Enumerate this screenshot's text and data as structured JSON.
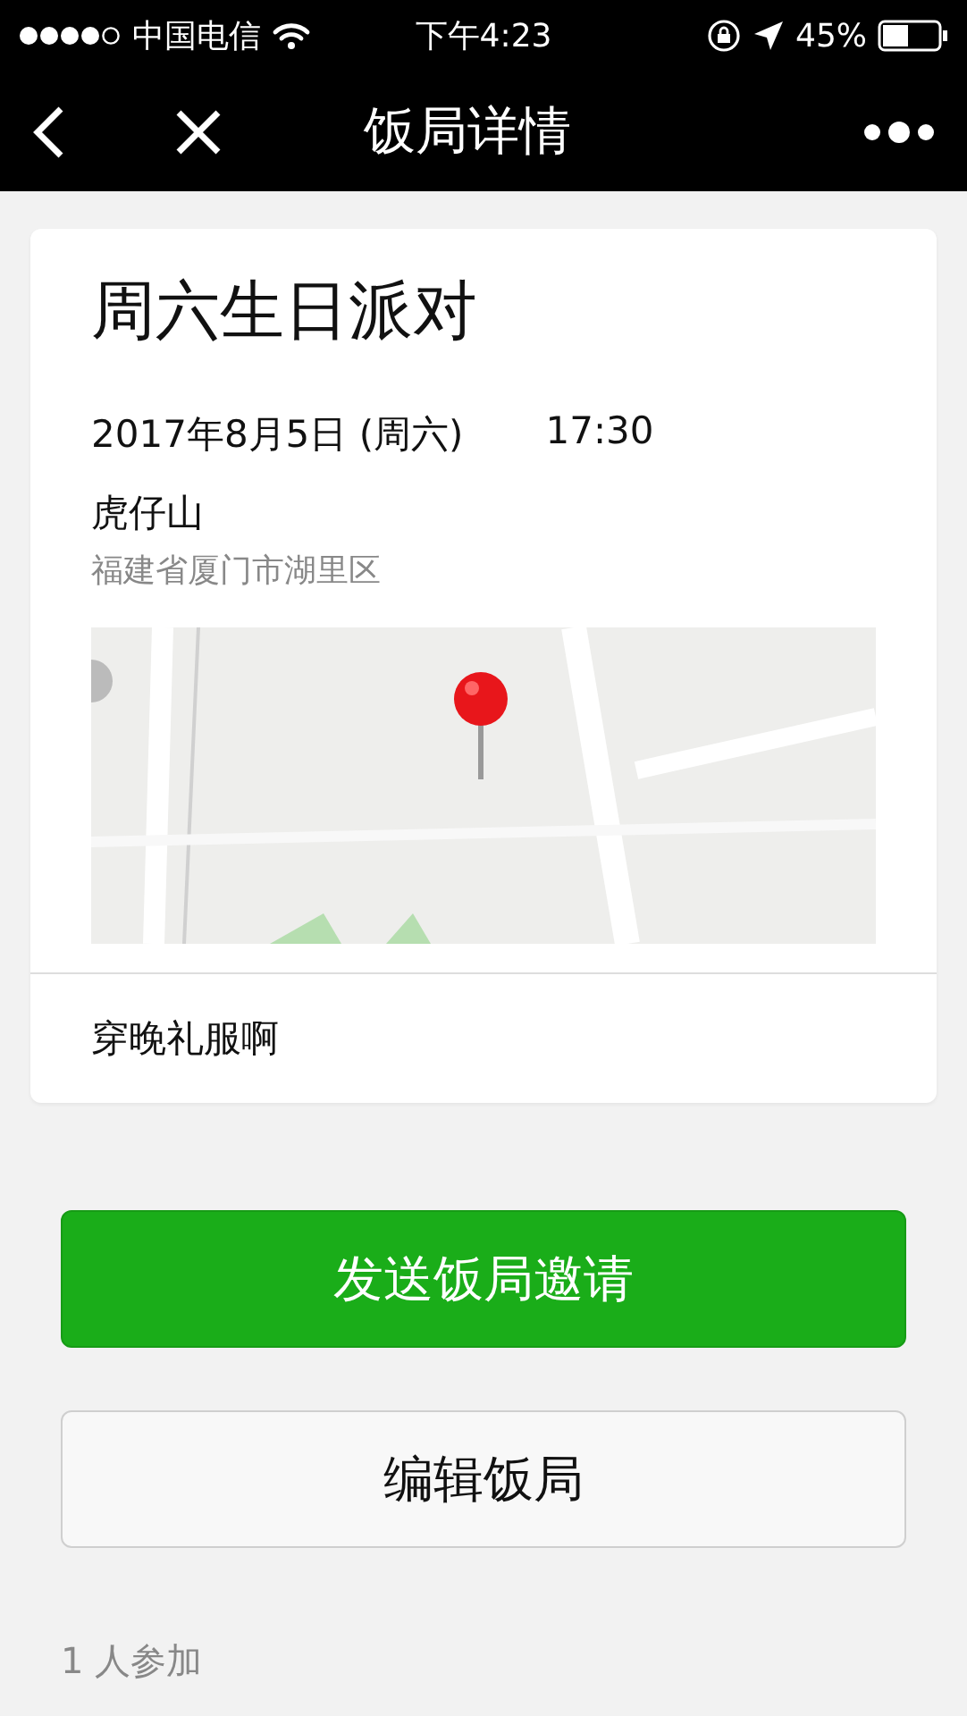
{
  "status_bar": {
    "carrier": "中国电信",
    "time": "下午4:23",
    "battery": "45%"
  },
  "nav": {
    "title": "饭局详情"
  },
  "event": {
    "title": "周六生日派对",
    "date": "2017年8月5日 (周六)",
    "time": "17:30",
    "place": "虎仔山",
    "address": "福建省厦门市湖里区",
    "note": "穿晚礼服啊"
  },
  "buttons": [
    {
      "label": "发送饭局邀请",
      "kind": "primary"
    },
    {
      "label": "编辑饭局",
      "kind": "default"
    }
  ],
  "participants": "1 人参加"
}
